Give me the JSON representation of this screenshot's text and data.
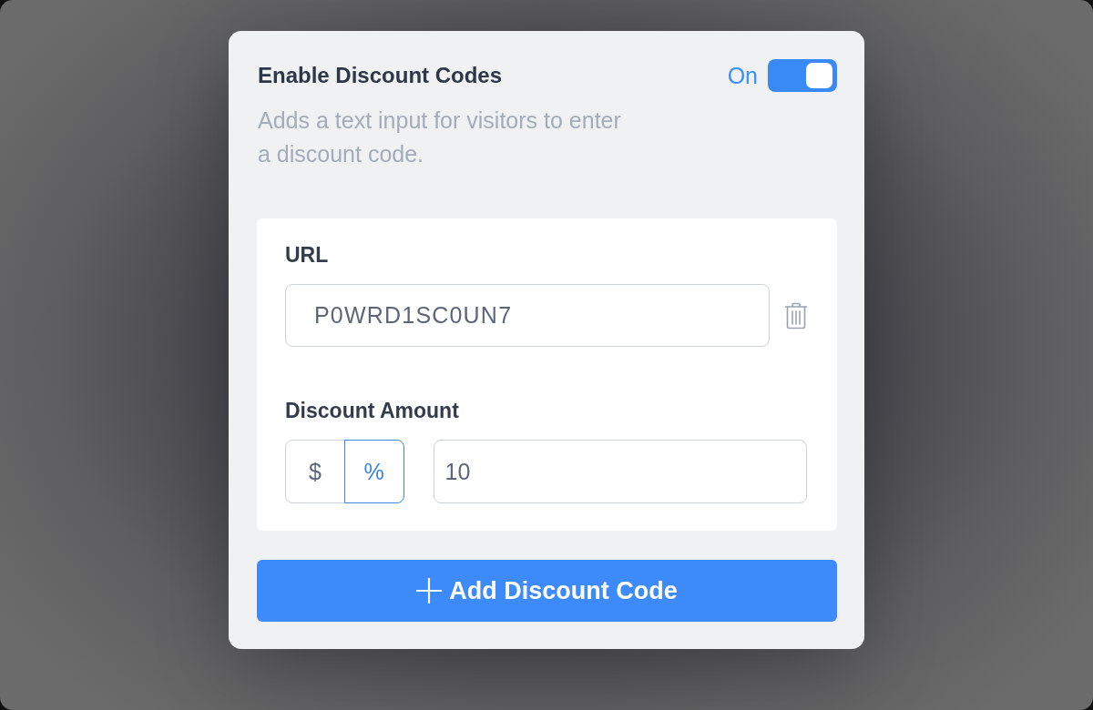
{
  "panel": {
    "title": "Enable Discount Codes",
    "toggle": {
      "label": "On",
      "on": true
    },
    "description": "Adds a text input for visitors to enter a discount code."
  },
  "codes": [
    {
      "url_label": "URL",
      "url_value": "P0WRD1SC0UN7",
      "amount_label": "Discount Amount",
      "units": [
        {
          "label": "$",
          "selected": false
        },
        {
          "label": "%",
          "selected": true
        }
      ],
      "amount_value": "10"
    }
  ],
  "add_button": {
    "label": "Add Discount Code"
  }
}
